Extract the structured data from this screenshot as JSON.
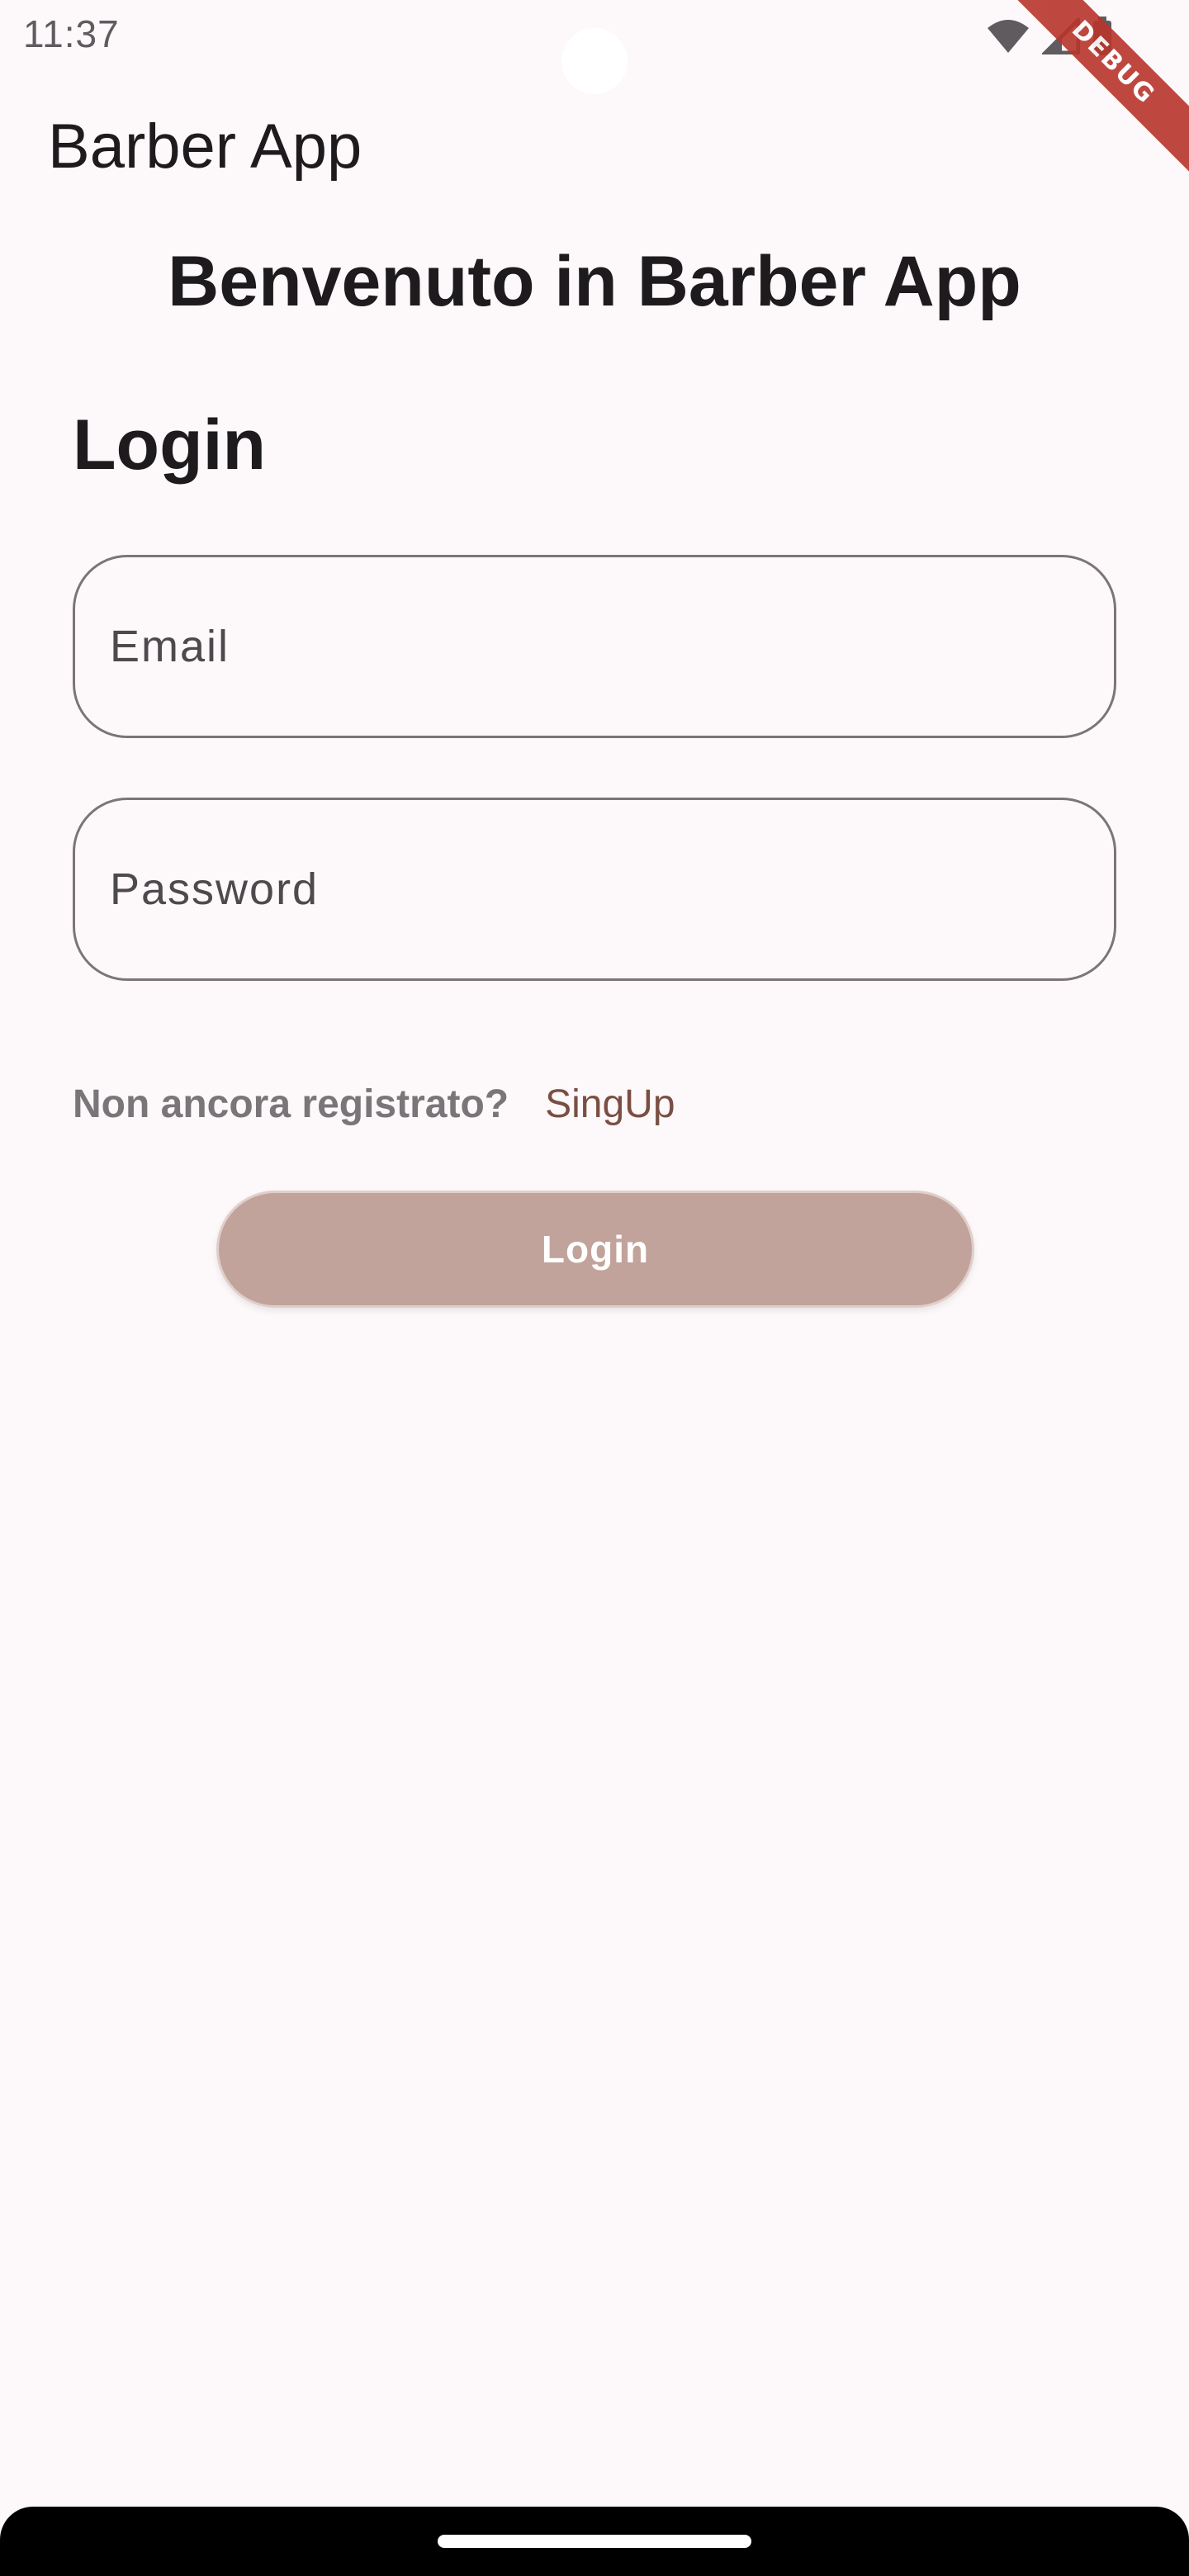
{
  "status_bar": {
    "time": "11:37",
    "icons": [
      "wifi-icon",
      "signal-icon",
      "battery-icon"
    ]
  },
  "debug_banner": "DEBUG",
  "app_bar": {
    "title": "Barber App"
  },
  "welcome_text": "Benvenuto in Barber App",
  "login_heading": "Login",
  "form": {
    "email": {
      "placeholder": "Email",
      "value": ""
    },
    "password": {
      "placeholder": "Password",
      "value": ""
    }
  },
  "signup": {
    "prompt": "Non ancora registrato?",
    "link_label": "SingUp"
  },
  "login_button_label": "Login",
  "colors": {
    "background": "#fdf8fa",
    "button": "#c2a39b",
    "link": "#7a4f43",
    "debug_banner": "#b8352c"
  }
}
